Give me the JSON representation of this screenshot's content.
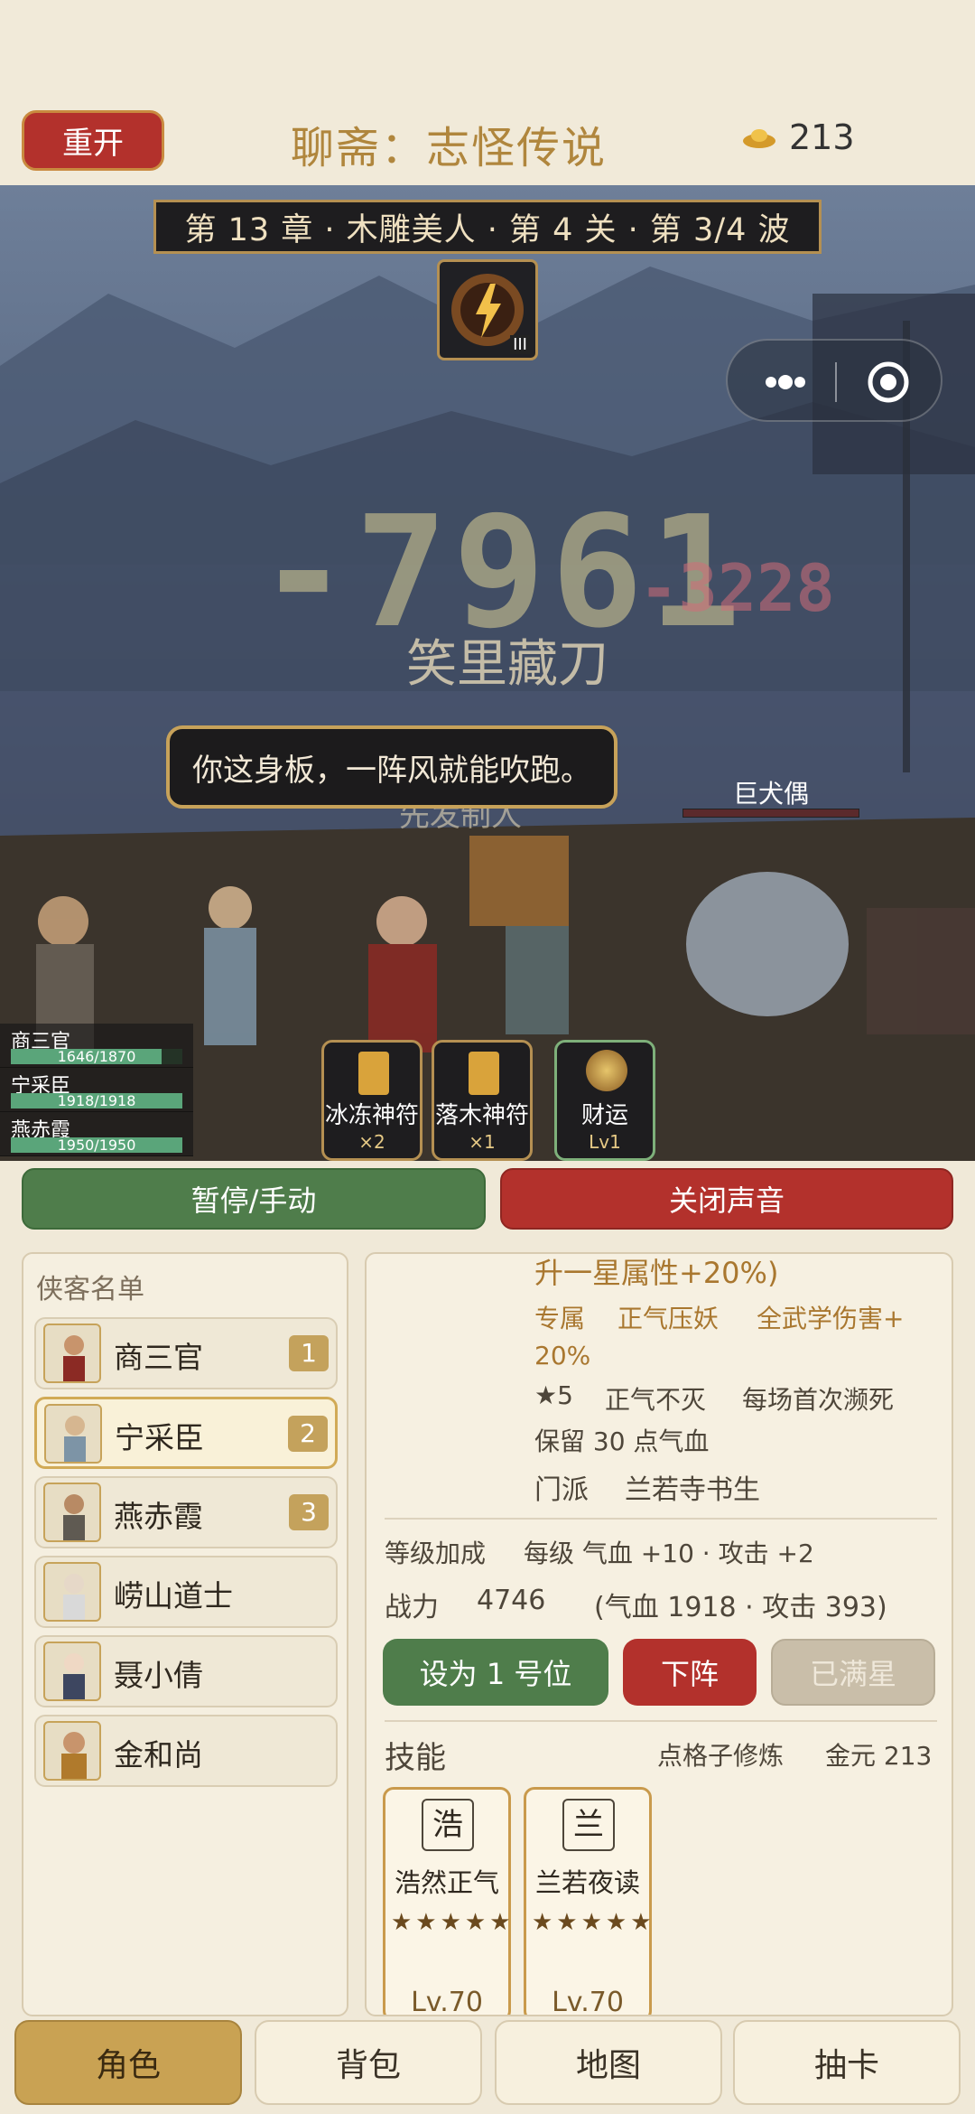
{
  "header": {
    "restart_label": "重开",
    "title": "聊斋：志怪传说",
    "gold": "213"
  },
  "battle": {
    "stage": "第 13 章 · 木雕美人 · 第 4 关 · 第 3/4 波",
    "boss_level": "III",
    "damage_big": "-7961",
    "damage_small": "-3228",
    "skill_float": "笑里藏刀",
    "skill_float2": "先发制人",
    "speech": "你这身板，一阵风就能吹跑。",
    "enemy_name": "巨犬偶",
    "party": [
      {
        "name": "商三官",
        "hp": "1646/1870",
        "ratio": 0.88
      },
      {
        "name": "宁采臣",
        "hp": "1918/1918",
        "ratio": 1.0
      },
      {
        "name": "燕赤霞",
        "hp": "1950/1950",
        "ratio": 1.0
      }
    ],
    "talismans": [
      {
        "name": "冰冻神符",
        "sub": "×2"
      },
      {
        "name": "落木神符",
        "sub": "×1"
      },
      {
        "name": "财运",
        "sub": "Lv1"
      }
    ]
  },
  "controls": {
    "pause_label": "暂停/手动",
    "mute_label": "关闭声音"
  },
  "roster": {
    "title": "侠客名单",
    "heroes": [
      {
        "name": "商三官",
        "slot": "1"
      },
      {
        "name": "宁采臣",
        "slot": "2"
      },
      {
        "name": "燕赤霞",
        "slot": "3"
      },
      {
        "name": "崂山道士",
        "slot": ""
      },
      {
        "name": "聂小倩",
        "slot": ""
      },
      {
        "name": "金和尚",
        "slot": ""
      }
    ]
  },
  "detail": {
    "star_line": "升一星属性+20%)",
    "exclusive_label": "专属",
    "exclusive_name": "正气压妖",
    "exclusive_desc_1": "全武学伤害+",
    "exclusive_desc_2": "20%",
    "star5_label": "★5",
    "star5_name": "正气不灭",
    "star5_desc_1": "每场首次濒死",
    "star5_desc_2": "保留 30 点气血",
    "sect_label": "门派",
    "sect_name": "兰若寺书生",
    "level_bonus_label": "等级加成",
    "level_bonus": "每级 气血 +10 · 攻击 +2",
    "power_label": "战力",
    "power": "4746",
    "power_detail": "(气血 1918 · 攻击 393)",
    "set_first_label": "设为 1 号位",
    "withdraw_label": "下阵",
    "maxstar_label": "已满星",
    "skills_title": "技能",
    "skills_hint": "点格子修炼",
    "skills_gold": "金元 213",
    "skills": [
      {
        "glyph": "浩",
        "name": "浩然正气",
        "stars": "★★★★★",
        "level": "Lv.70"
      },
      {
        "glyph": "兰",
        "name": "兰若夜读",
        "stars": "★★★★★",
        "level": "Lv.70"
      }
    ]
  },
  "tabs": [
    "角色",
    "背包",
    "地图",
    "抽卡"
  ],
  "colors": {
    "accent_red": "#b3312c",
    "accent_green": "#4f7d4b",
    "accent_gold": "#c9a253",
    "title_gold": "#b0863d"
  }
}
